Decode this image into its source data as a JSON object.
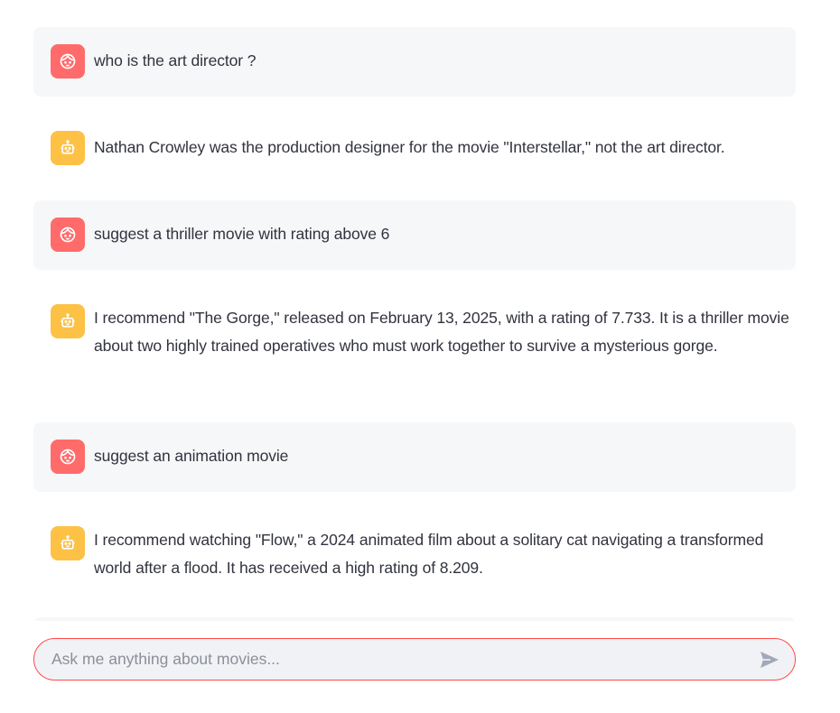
{
  "colors": {
    "user_avatar": "#ff6b6b",
    "bot_avatar": "#fdc145",
    "user_bubble": "#f6f7f9",
    "input_border": "#ff4b4b",
    "input_bg": "#f0f2f6"
  },
  "messages": [
    {
      "role": "user",
      "icon": "user-face-icon",
      "text": "who is the art director ?"
    },
    {
      "role": "assistant",
      "icon": "robot-icon",
      "text": "Nathan Crowley was the production designer for the movie \"Interstellar,\" not the art director."
    },
    {
      "role": "user",
      "icon": "user-face-icon",
      "text": "suggest a thriller movie with rating above 6"
    },
    {
      "role": "assistant",
      "icon": "robot-icon",
      "text": "I recommend \"The Gorge,\" released on February 13, 2025, with a rating of 7.733. It is a thriller movie about two highly trained operatives who must work together to survive a mysterious gorge."
    },
    {
      "role": "user",
      "icon": "user-face-icon",
      "text": "suggest an animation movie"
    },
    {
      "role": "assistant",
      "icon": "robot-icon",
      "text": "I recommend watching \"Flow,\" a 2024 animated film about a solitary cat navigating a transformed world after a flood. It has received a high rating of 8.209."
    }
  ],
  "chat_input": {
    "placeholder": "Ask me anything about movies...",
    "value": "",
    "send_icon": "send-icon"
  }
}
